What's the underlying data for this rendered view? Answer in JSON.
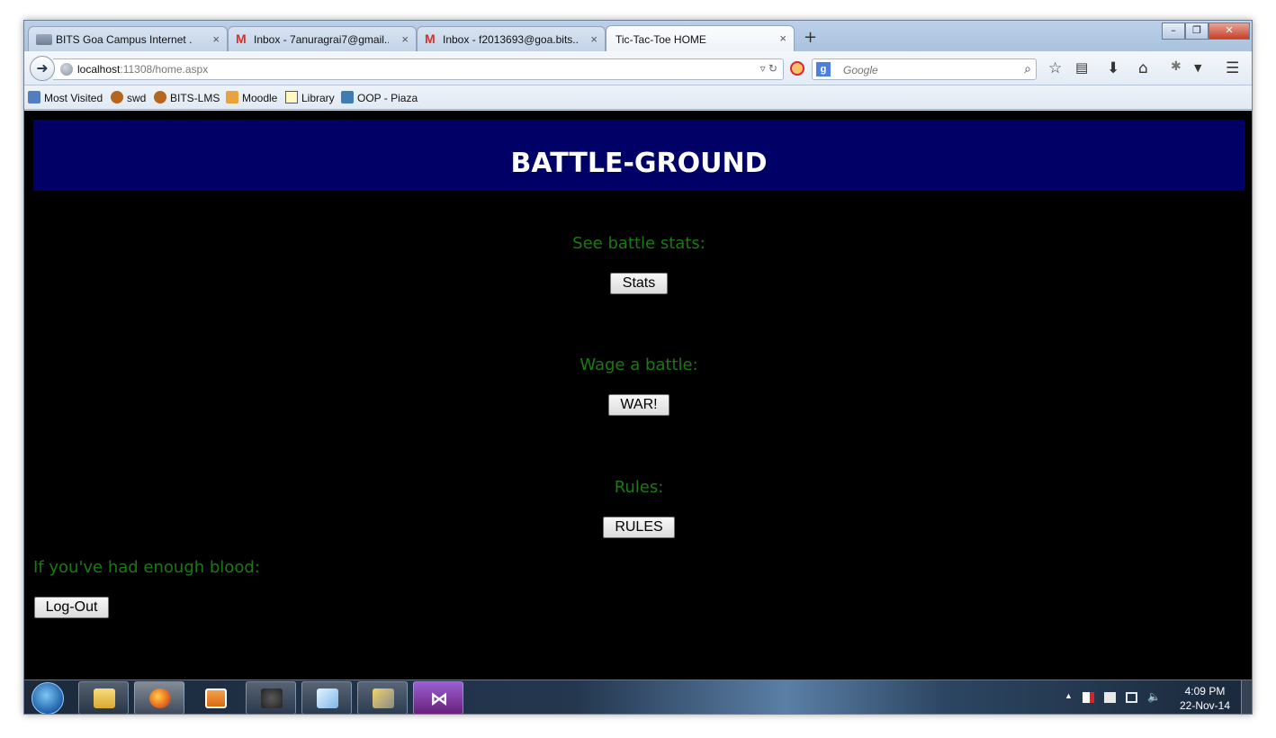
{
  "browser": {
    "tabs": [
      {
        "label": "BITS Goa Campus Internet ...",
        "active": false,
        "icon": "network-icon"
      },
      {
        "label": "Inbox - 7anuragrai7@gmail...",
        "active": false,
        "icon": "gmail-icon"
      },
      {
        "label": "Inbox - f2013693@goa.bits...",
        "active": false,
        "icon": "gmail-icon"
      },
      {
        "label": "Tic-Tac-Toe HOME",
        "active": true,
        "icon": "none"
      }
    ],
    "close_glyph": "×",
    "new_tab_glyph": "+",
    "window_buttons": {
      "minimize": "–",
      "restore": "❐",
      "close": "✕"
    },
    "address": {
      "host": "localhost",
      "rest": ":11308/home.aspx"
    },
    "search": {
      "engine_letter": "g",
      "placeholder": "Google"
    },
    "bookmarks": [
      "Most Visited",
      "swd",
      "BITS-LMS",
      "Moodle",
      "Library",
      "OOP - Piaza"
    ]
  },
  "page": {
    "banner_title": "BATTLE-GROUND",
    "stats_label": "See battle stats:",
    "stats_button": "Stats",
    "war_label": "Wage a battle:",
    "war_button": "WAR!",
    "rules_label": "Rules:",
    "rules_button": "RULES",
    "logout_label": "If you've had enough blood:",
    "logout_button": "Log-Out"
  },
  "taskbar": {
    "time": "4:09 PM",
    "date": "22-Nov-14",
    "tray_arrow": "▲"
  },
  "colors": {
    "banner_bg": "#000066",
    "label_green": "#1a7a12",
    "page_bg": "#000000"
  }
}
